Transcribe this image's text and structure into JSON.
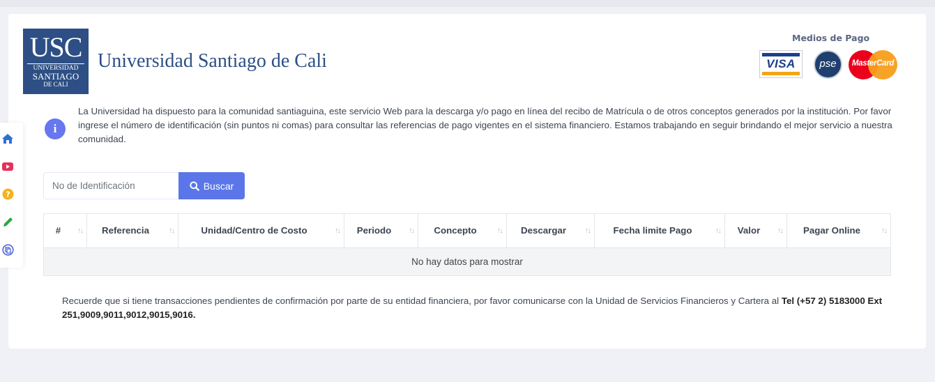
{
  "header": {
    "logo": {
      "big": "USC",
      "line1": "UNIVERSIDAD",
      "line2": "SANTIAGO",
      "line3": "DE CALI"
    },
    "title": "Universidad Santiago de Cali"
  },
  "payment": {
    "title": "Medios de Pago",
    "visa": "VISA",
    "pse": "pse",
    "mastercard": "MasterCard"
  },
  "info": {
    "icon": "i",
    "text": "La Universidad ha dispuesto para la comunidad santiaguina, este servicio Web para la descarga y/o pago en línea del recibo de Matrícula o de otros conceptos generados por la institución. Por favor ingrese el número de identificación (sin puntos ni comas) para consultar las referencias de pago vigentes en el sistema financiero. Estamos trabajando en seguir brindando el mejor servicio a nuestra comunidad."
  },
  "search": {
    "placeholder": "No de Identificación",
    "button_label": "Buscar"
  },
  "table": {
    "columns": [
      "#",
      "Referencia",
      "Unidad/Centro de Costo",
      "Periodo",
      "Concepto",
      "Descargar",
      "Fecha limite Pago",
      "Valor",
      "Pagar Online"
    ],
    "sort_icon": "↑↓",
    "empty_message": "No hay datos para mostrar"
  },
  "footer": {
    "text": "Recuerde que si tiene transacciones pendientes de confirmación por parte de su entidad financiera, por favor comunicarse con la Unidad de Servicios Financieros y Cartera al ",
    "phone": "Tel (+57 2) 5183000 Ext 251,9009,9011,9012,9015,9016."
  },
  "sidenav": {
    "items": [
      "home-icon",
      "youtube-icon",
      "help-icon",
      "edit-icon",
      "copy-icon"
    ],
    "colors": {
      "home": "#2f6fd6",
      "youtube": "#e8305a",
      "help": "#f6b21a",
      "edit": "#27a844",
      "copy": "#4f63d6"
    }
  }
}
